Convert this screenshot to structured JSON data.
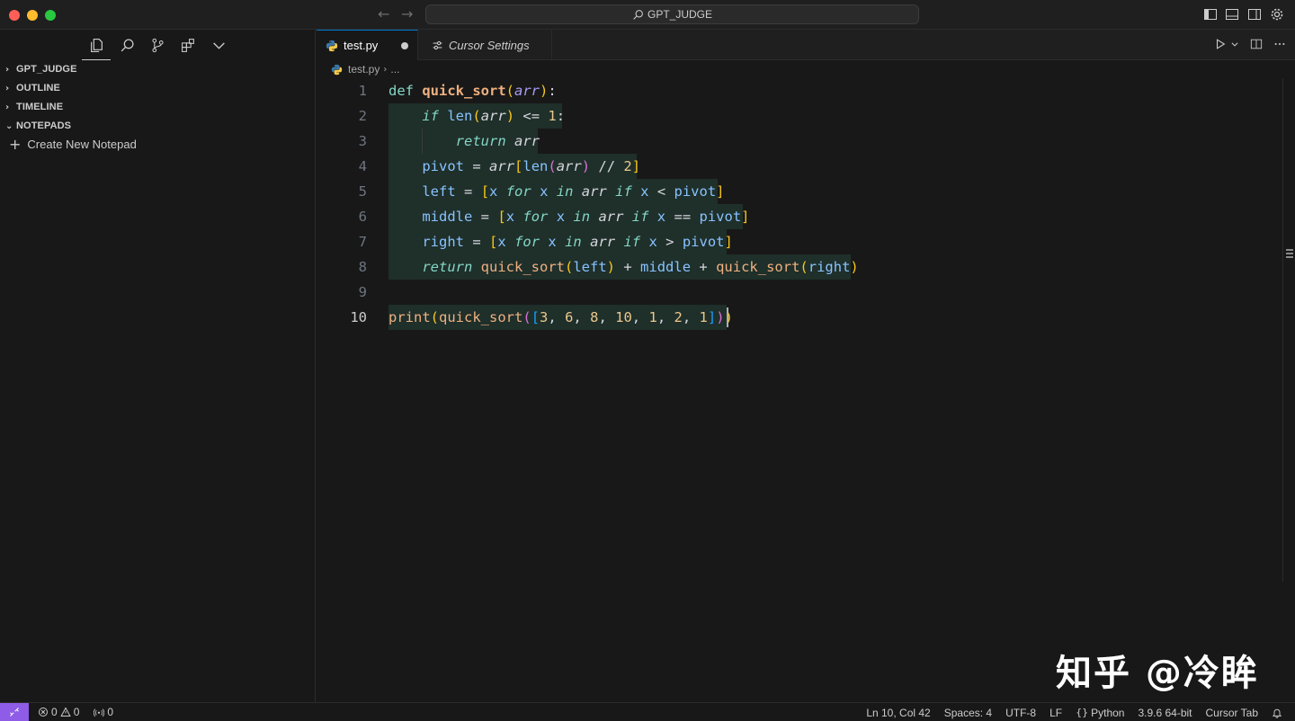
{
  "titlebar": {
    "search_text": "GPT_JUDGE",
    "back_arrow": "←",
    "forward_arrow": "→"
  },
  "sidebar": {
    "sections": [
      {
        "label": "GPT_JUDGE",
        "expanded": false
      },
      {
        "label": "OUTLINE",
        "expanded": false
      },
      {
        "label": "TIMELINE",
        "expanded": false
      },
      {
        "label": "NOTEPADS",
        "expanded": true
      }
    ],
    "create_notepad_label": "Create New Notepad"
  },
  "tabs": [
    {
      "label": "test.py",
      "active": true,
      "dirty": true
    },
    {
      "label": "Cursor Settings",
      "active": false
    }
  ],
  "breadcrumb": {
    "file": "test.py",
    "rest": "..."
  },
  "code": {
    "line_numbers": [
      "1",
      "2",
      "3",
      "4",
      "5",
      "6",
      "7",
      "8",
      "9",
      "10"
    ],
    "current_line": "10"
  },
  "watermark": "知乎 @冷眸",
  "statusbar": {
    "errors": "0",
    "warnings": "0",
    "ports": "0",
    "cursor_position": "Ln 10, Col 42",
    "indentation": "Spaces: 4",
    "encoding": "UTF-8",
    "eol": "LF",
    "language": "Python",
    "interpreter": "3.9.6 64-bit",
    "cursor_tab": "Cursor Tab"
  },
  "colors": {
    "accent": "#0078d4",
    "remote_indicator": "#8e5ce6",
    "selection_highlight": "#1f2f2a"
  },
  "icons": [
    "files-icon",
    "search-icon",
    "source-control-icon",
    "extensions-icon",
    "chevron-down-icon",
    "toggle-sidebar-icon",
    "toggle-panel-icon",
    "toggle-secondary-sidebar-icon",
    "gear-icon",
    "python-file-icon",
    "settings-icon",
    "run-icon",
    "split-editor-icon",
    "more-actions-icon",
    "error-icon",
    "warning-icon",
    "ports-icon",
    "bell-icon"
  ]
}
